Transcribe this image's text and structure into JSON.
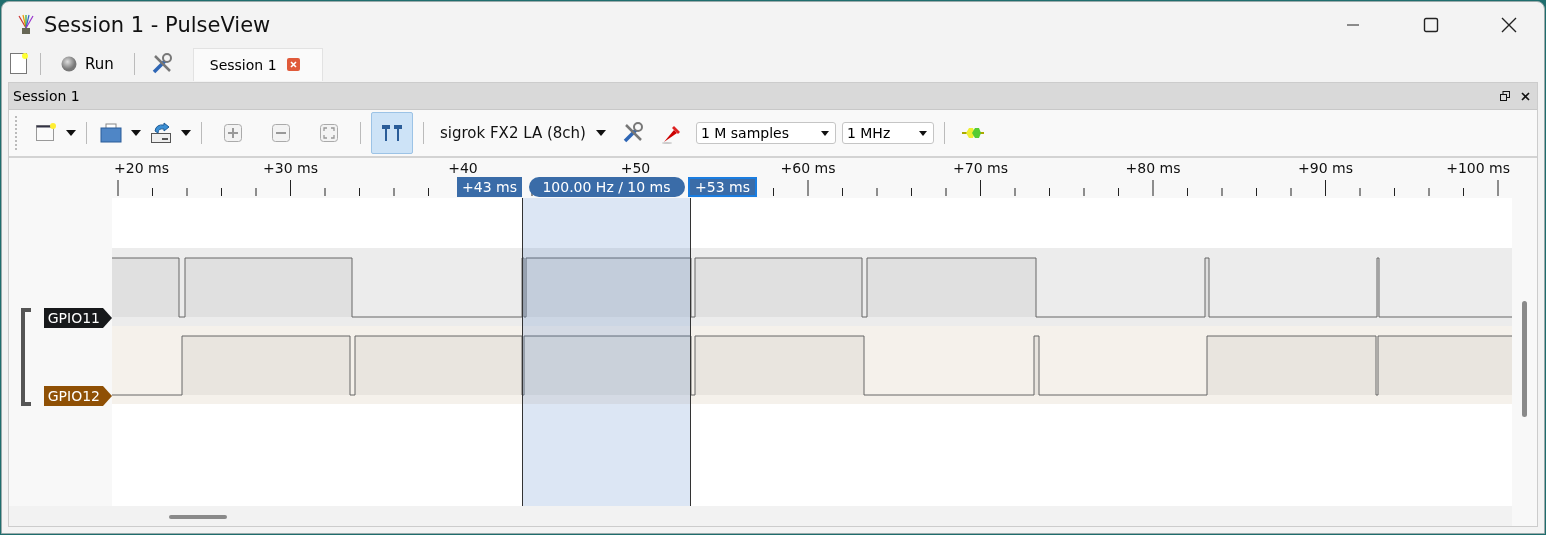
{
  "window": {
    "title": "Session 1 - PulseView"
  },
  "main_toolbar": {
    "run_label": "Run"
  },
  "tabs": [
    {
      "label": "Session 1",
      "selected": true
    }
  ],
  "dock": {
    "title": "Session 1"
  },
  "session_toolbar": {
    "cursor_toggle_on": true,
    "device": "sigrok FX2 LA (8ch)",
    "samples": "1 M samples",
    "samplerate": "1 MHz"
  },
  "ruler": {
    "labels": [
      "+20 ms",
      "+30 ms",
      "+40",
      "+50",
      "+60 ms",
      "+70 ms",
      "+80 ms",
      "+90 ms",
      "+100 ms"
    ]
  },
  "cursors": {
    "left": "+43 ms",
    "span": "100.00 Hz / 10 ms",
    "right": "+53 ms"
  },
  "signals": [
    {
      "name": "GPIO11",
      "color": "#17191b"
    },
    {
      "name": "GPIO12",
      "color": "#8f5005"
    }
  ]
}
